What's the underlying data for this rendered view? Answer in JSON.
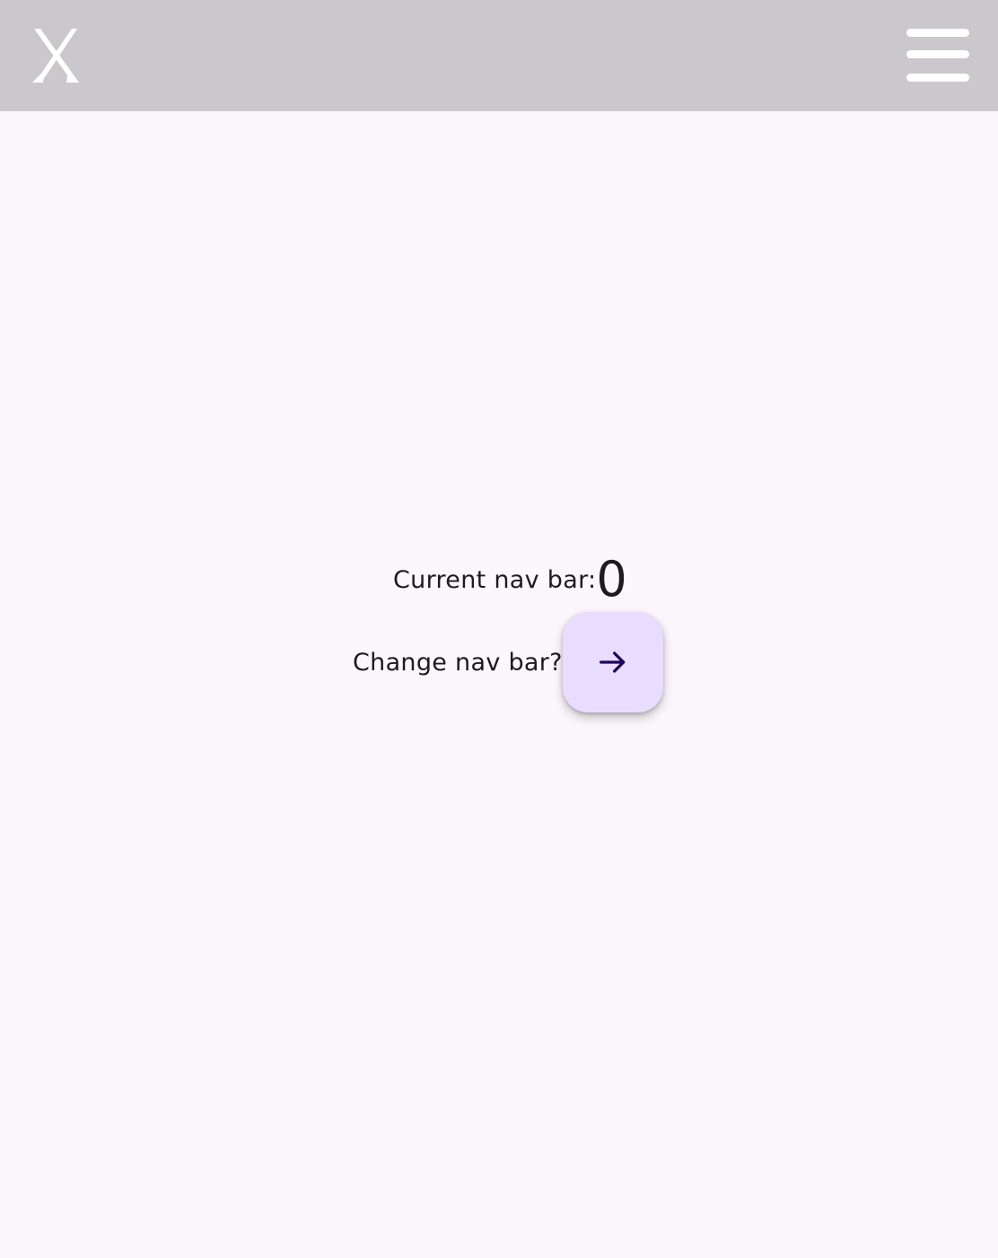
{
  "app_bar": {
    "logo_icon": "x-logo-icon",
    "menu_icon": "hamburger-menu-icon",
    "background": "#cbc8cd"
  },
  "main": {
    "current_label": "Current nav bar:",
    "current_value": "0",
    "change_label": "Change nav bar?",
    "fab_icon": "arrow-right-icon",
    "fab_color": "#e9ddff",
    "icon_color": "#21005d"
  }
}
